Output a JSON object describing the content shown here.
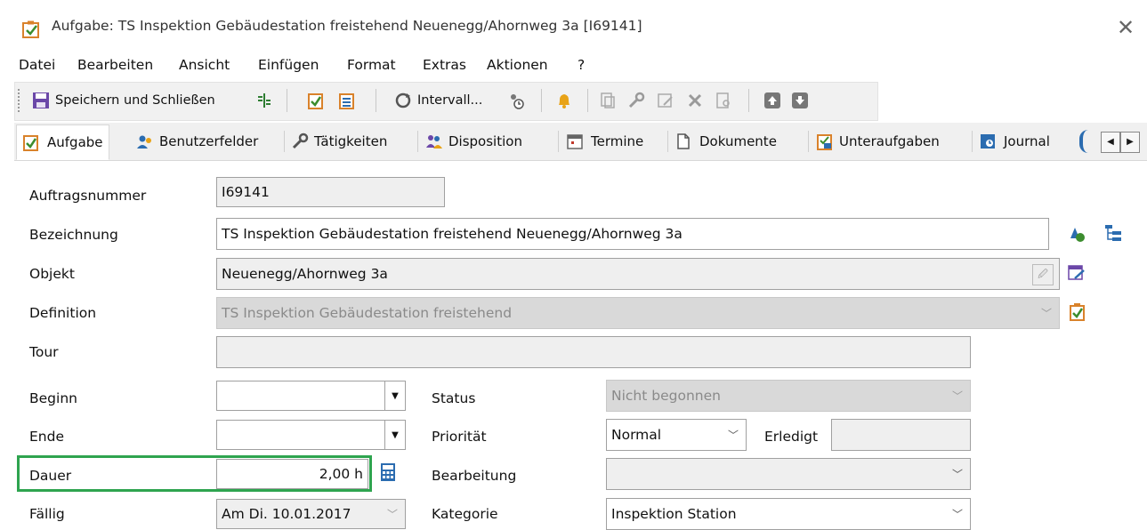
{
  "window": {
    "title": "Aufgabe: TS Inspektion Gebäudestation freistehend Neuenegg/Ahornweg 3a [I69141]",
    "close_symbol": "✕"
  },
  "menu": {
    "items": [
      "Datei",
      "Bearbeiten",
      "Ansicht",
      "Einfügen",
      "Format",
      "Extras",
      "Aktionen",
      "?"
    ]
  },
  "toolbar": {
    "save_close_label": "Speichern und Schließen",
    "interval_label": "Intervall..."
  },
  "tabs": [
    "Aufgabe",
    "Benutzerfelder",
    "Tätigkeiten",
    "Disposition",
    "Termine",
    "Dokumente",
    "Unteraufgaben",
    "Journal"
  ],
  "form": {
    "auftragsnummer": {
      "label": "Auftragsnummer",
      "value": "I69141"
    },
    "bezeichnung": {
      "label": "Bezeichnung",
      "value": "TS Inspektion Gebäudestation freistehend Neuenegg/Ahornweg 3a"
    },
    "objekt": {
      "label": "Objekt",
      "value": "Neuenegg/Ahornweg 3a"
    },
    "definition": {
      "label": "Definition",
      "value": "TS Inspektion Gebäudestation freistehend"
    },
    "tour": {
      "label": "Tour",
      "value": ""
    },
    "beginn": {
      "label": "Beginn",
      "value": ""
    },
    "ende": {
      "label": "Ende",
      "value": ""
    },
    "dauer": {
      "label": "Dauer",
      "value": "2,00 h"
    },
    "faellig": {
      "label": "Fällig",
      "value": "Am Di. 10.01.2017"
    },
    "status": {
      "label": "Status",
      "value": "Nicht begonnen"
    },
    "prioritaet": {
      "label": "Priorität",
      "value": "Normal"
    },
    "erledigt": {
      "label": "Erledigt",
      "value": ""
    },
    "bearbeitung": {
      "label": "Bearbeitung",
      "value": ""
    },
    "kategorie": {
      "label": "Kategorie",
      "value": "Inspektion Station"
    }
  },
  "colors": {
    "highlight": "#2ea44f",
    "accent_orange": "#e8a317",
    "accent_blue": "#2b6cb0"
  }
}
